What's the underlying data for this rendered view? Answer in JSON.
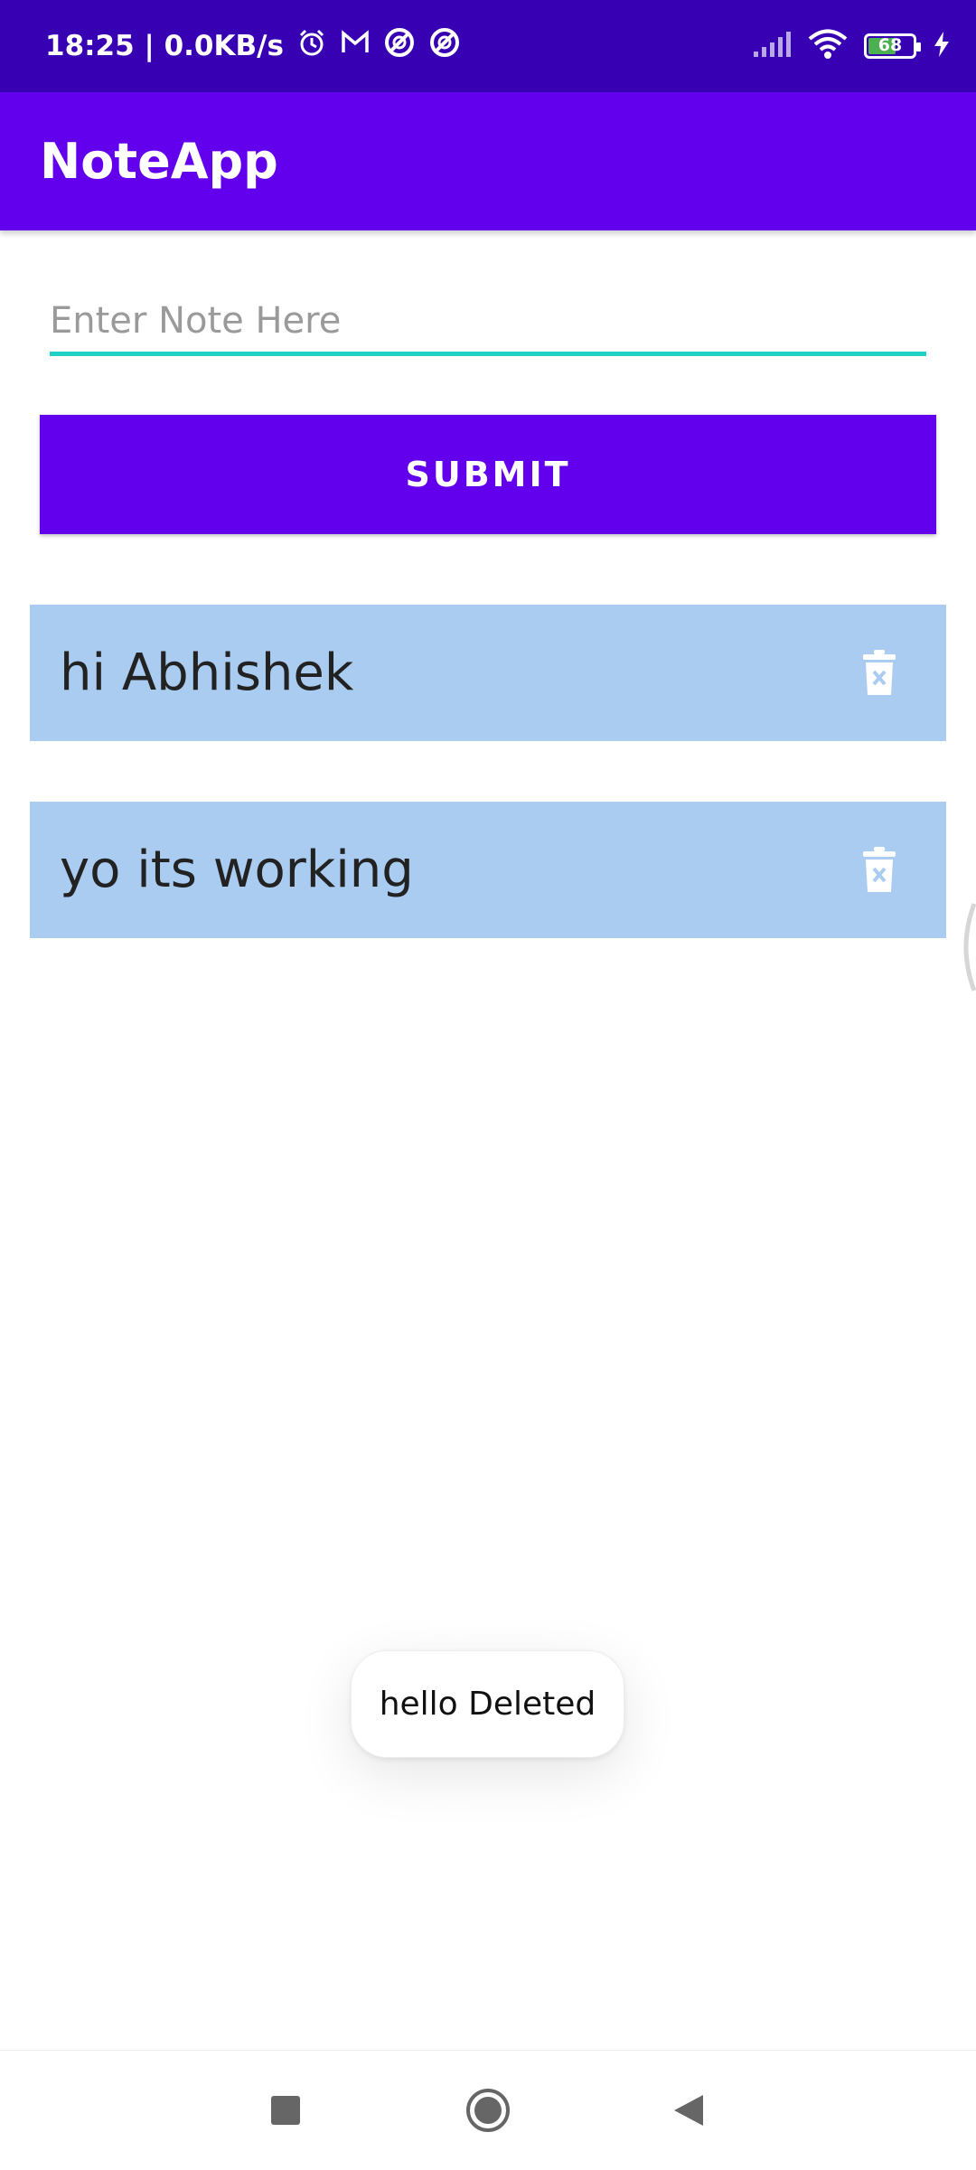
{
  "status_bar": {
    "time_speed": "18:25 | 0.0KB/s",
    "battery_level": "68",
    "icons": [
      "alarm-icon",
      "gmail-icon",
      "app-icon",
      "app-icon",
      "signal-icon",
      "wifi-icon",
      "battery-icon",
      "charging-icon"
    ]
  },
  "app_bar": {
    "title": "NoteApp"
  },
  "form": {
    "input_value": "",
    "input_placeholder": "Enter Note Here",
    "submit_label": "SUBMIT"
  },
  "notes": [
    {
      "text": "hi Abhishek",
      "delete_icon": "delete-icon"
    },
    {
      "text": "yo its working",
      "delete_icon": "delete-icon"
    }
  ],
  "toast": {
    "message": "hello Deleted"
  },
  "nav_bar": {
    "icons": [
      "recent-apps-icon",
      "home-icon",
      "back-icon"
    ]
  },
  "colors": {
    "status_bar": "#3700B3",
    "primary": "#6200EE",
    "input_underline": "#1FD0C6",
    "note_background": "#AACCF0"
  }
}
